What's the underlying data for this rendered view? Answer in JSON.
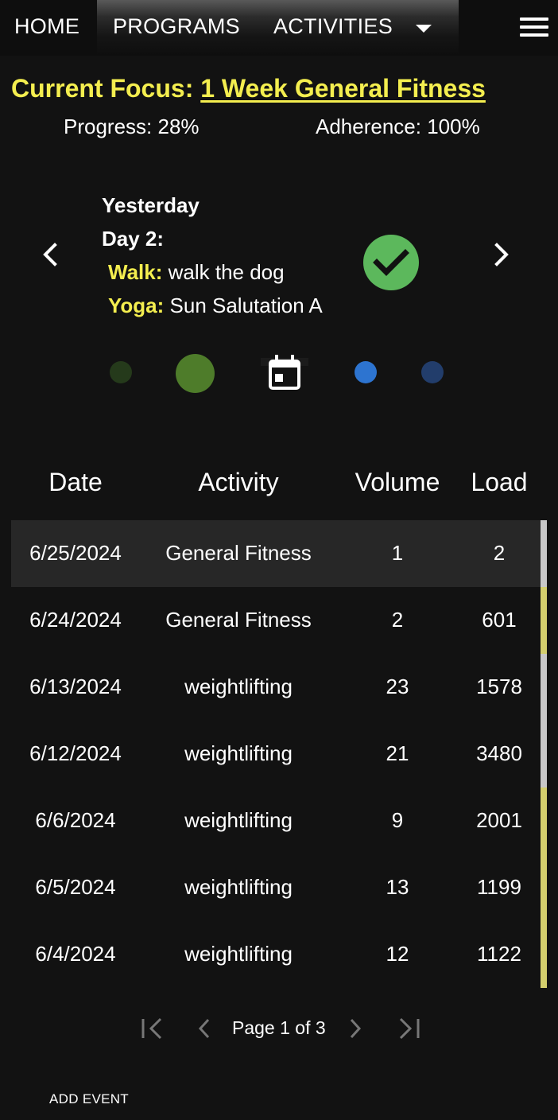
{
  "nav": {
    "home": "HOME",
    "programs": "PROGRAMS",
    "activities": "ACTIVITIES",
    "caret_icon": "caret-down-icon",
    "menu_icon": "hamburger-menu-icon"
  },
  "focus": {
    "label": "Current Focus: ",
    "program": "1 Week General Fitness",
    "progress": "Progress: 28%",
    "adherence": "Adherence: 100%"
  },
  "day_card": {
    "when": "Yesterday",
    "title": "Day 2:",
    "activities": [
      {
        "name": "Walk:",
        "detail": " walk the dog"
      },
      {
        "name": "Yoga:",
        "detail": " Sun Salutation A"
      }
    ],
    "status_icon": "check-circle-icon",
    "status_color": "#5cb85c"
  },
  "carousel": {
    "dot_colors": [
      "#253a1b",
      "#4e7c2a",
      "#2d74d0",
      "#223d6b"
    ],
    "center_icon": "calendar-today-icon"
  },
  "table": {
    "headers": [
      "Date",
      "Activity",
      "Volume",
      "Load"
    ],
    "rows": [
      {
        "date": "6/25/2024",
        "activity": "General Fitness",
        "volume": "1",
        "load": "2"
      },
      {
        "date": "6/24/2024",
        "activity": "General Fitness",
        "volume": "2",
        "load": "601"
      },
      {
        "date": "6/13/2024",
        "activity": "weightlifting",
        "volume": "23",
        "load": "1578"
      },
      {
        "date": "6/12/2024",
        "activity": "weightlifting",
        "volume": "21",
        "load": "3480"
      },
      {
        "date": "6/6/2024",
        "activity": "weightlifting",
        "volume": "9",
        "load": "2001"
      },
      {
        "date": "6/5/2024",
        "activity": "weightlifting",
        "volume": "13",
        "load": "1199"
      },
      {
        "date": "6/4/2024",
        "activity": "weightlifting",
        "volume": "12",
        "load": "1122"
      }
    ]
  },
  "pagination": {
    "text": "Page 1 of 3",
    "icons": [
      "first-page-icon",
      "prev-page-icon",
      "next-page-icon",
      "last-page-icon"
    ]
  },
  "actions": {
    "add_event": "ADD EVENT"
  },
  "colors": {
    "accent_yellow": "#f4ee4f",
    "background": "#121212",
    "selected_row": "#272727"
  }
}
